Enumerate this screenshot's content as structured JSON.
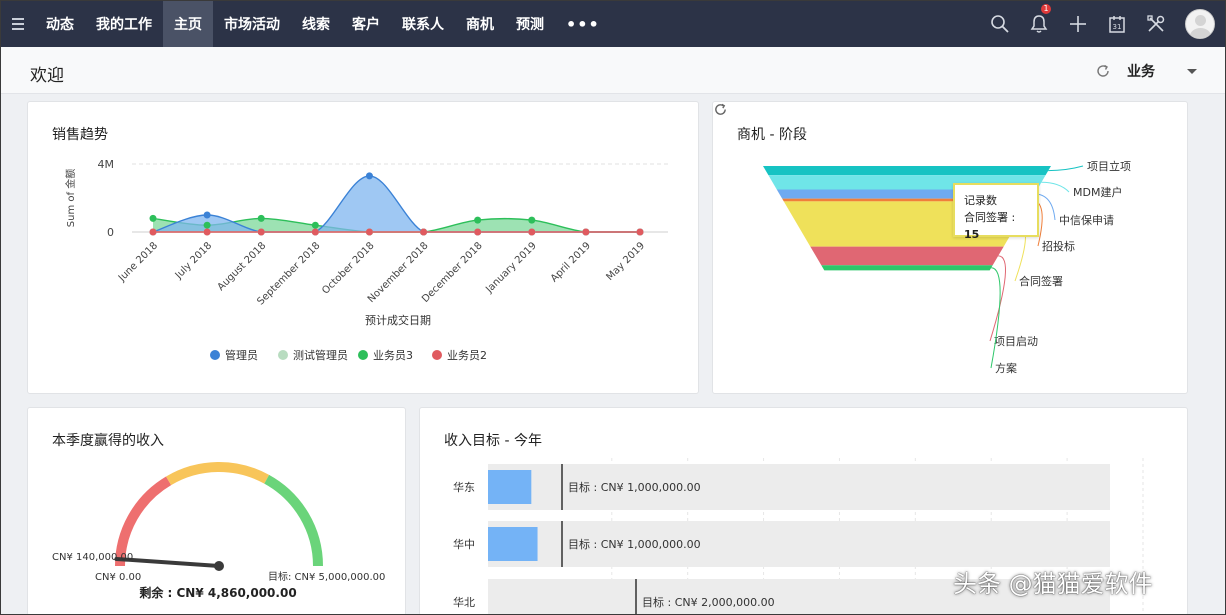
{
  "nav": {
    "items": [
      {
        "label": "动态"
      },
      {
        "label": "我的工作"
      },
      {
        "label": "主页",
        "active": true
      },
      {
        "label": "市场活动"
      },
      {
        "label": "线索"
      },
      {
        "label": "客户"
      },
      {
        "label": "联系人"
      },
      {
        "label": "商机"
      },
      {
        "label": "预测"
      }
    ],
    "more_label": "•••",
    "notification_count": "1",
    "calendar_day": "31",
    "colors": {
      "bar": "#2c3347",
      "active": "#4a5266",
      "badge": "#e03a3a"
    }
  },
  "header": {
    "title": "欢迎",
    "view_label": "业务"
  },
  "sales_trend": {
    "title": "销售趋势",
    "chart_data": {
      "type": "area",
      "ylabel": "Sum of 金额",
      "xlabel": "预计成交日期",
      "y_ticks": [
        "4M",
        "0"
      ],
      "ylim": [
        0,
        4000000
      ],
      "categories": [
        "June 2018",
        "July 2018",
        "August 2018",
        "September 2018",
        "October 2018",
        "November 2018",
        "December 2018",
        "January 2019",
        "April 2019",
        "May 2019"
      ],
      "legend_position": "bottom",
      "grid": true,
      "series": [
        {
          "name": "管理员",
          "color": "#3b82d6",
          "fill": "#7fb5ef",
          "values": [
            0,
            1000000,
            0,
            0,
            3300000,
            0,
            0,
            0,
            0,
            0
          ]
        },
        {
          "name": "测试管理员",
          "color": "#b8dcc0",
          "fill": "#cfe9d5",
          "values": [
            0,
            0,
            0,
            0,
            0,
            0,
            0,
            0,
            0,
            0
          ]
        },
        {
          "name": "业务员3",
          "color": "#2dbf5a",
          "fill": "#7cd89a",
          "values": [
            800000,
            400000,
            800000,
            400000,
            0,
            0,
            700000,
            700000,
            0,
            0
          ]
        },
        {
          "name": "业务员2",
          "color": "#e05a5f",
          "fill": "#f0a3a6",
          "values": [
            0,
            0,
            0,
            0,
            0,
            0,
            0,
            0,
            0,
            0
          ]
        }
      ]
    }
  },
  "stage_funnel": {
    "title": "商机 - 阶段",
    "chart_data": {
      "type": "funnel",
      "stages": [
        {
          "label": "项目立项",
          "color": "#16c3c3",
          "rel_height": 0.77
        },
        {
          "label": "MDM建户",
          "color": "#6fe5e8",
          "rel_height": 1.2
        },
        {
          "label": "中信保申请",
          "color": "#6faaf0",
          "rel_height": 0.77
        },
        {
          "label": "招投标",
          "color": "#f07f3a",
          "rel_height": 0.23
        },
        {
          "label": "合同签署",
          "color": "#efe15a",
          "rel_height": 3.8
        },
        {
          "label": "项目启动",
          "color": "#e06773",
          "rel_height": 1.57
        },
        {
          "label": "方案",
          "color": "#2ec76a",
          "rel_height": 0.43
        }
      ],
      "tooltip": {
        "title": "记录数",
        "series": "合同签署",
        "value": "15"
      }
    }
  },
  "quarter_revenue": {
    "title": "本季度赢得的收入",
    "chart_data": {
      "type": "gauge",
      "min_label": "CN¥ 0.00",
      "target_label": "目标: CN¥ 5,000,000.00",
      "value_label": "CN¥ 140,000.00",
      "remaining_label": "剩余 : CN¥ 4,860,000.00",
      "min": 0,
      "max": 5000000,
      "value": 140000,
      "bands": [
        {
          "from": 0,
          "to": 0.33,
          "color": "#ee6f6f"
        },
        {
          "from": 0.33,
          "to": 0.66,
          "color": "#f8c55a"
        },
        {
          "from": 0.66,
          "to": 1,
          "color": "#6ad47a"
        }
      ]
    }
  },
  "revenue_target": {
    "title": "收入目标 - 今年",
    "chart_data": {
      "type": "bar",
      "orientation": "horizontal",
      "xlim": [
        0,
        10000000
      ],
      "categories": [
        "华东",
        "华中",
        "华北"
      ],
      "values": [
        600000,
        700000,
        0
      ],
      "targets": [
        1000000,
        1000000,
        2000000
      ],
      "target_labels": [
        "目标 : CN¥ 1,000,000.00",
        "目标 : CN¥ 1,000,000.00",
        "目标 : CN¥ 2,000,000.00"
      ],
      "bar_color": "#74b3f6",
      "track_color": "#ececec"
    }
  },
  "watermark": "头条 @猫猫爱软件"
}
